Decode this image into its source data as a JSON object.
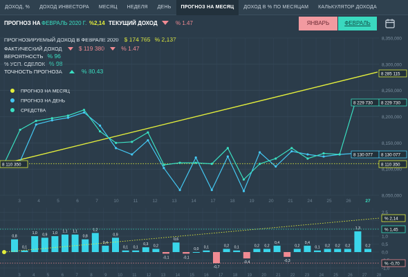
{
  "tabs": [
    "ДОХОД, %",
    "ДОХОД ИНВЕСТОРА",
    "МЕСЯЦ",
    "НЕДЕЛЯ",
    "ДЕНЬ",
    "ПРОГНОЗ НА МЕСЯЦ",
    "ДОХОД В % ПО МЕСЯЦАМ",
    "КАЛЬКУЛЯТОР ДОХОДА"
  ],
  "active_tab": 5,
  "header": {
    "prefix": "ПРОГНОЗ НА",
    "month": "ФЕВРАЛЬ 2020 Г.",
    "pct": "%2,14",
    "label": "ТЕКУЩИЙ ДОХОД",
    "current": "% 1.47"
  },
  "buttons": {
    "jan": "ЯНВАРЬ",
    "feb": "ФЕВРАЛЬ"
  },
  "info": {
    "forecast_label": "ПРОГНОЗИРУЕМЫЙ ДОХОД В ФЕВРАЛЕ 2020",
    "forecast_value": "$ 174 765",
    "forecast_pct": "% 2,137",
    "actual_label": "ФАКТИЧЕСКИЙ ДОХОД",
    "actual_value": "$ 119 380",
    "actual_pct": "% 1.47",
    "prob_label": "ВЕРОЯТНОСТЬ",
    "prob_value": "% 96",
    "deals_label": "% УСП. СДЕЛОК",
    "deals_value": "% 98",
    "acc_label": "ТОЧНОСТЬ ПРОГНОЗА",
    "acc_value": "% 80.43"
  },
  "legend": [
    {
      "name": "ПРОГНОЗ НА МЕСЯЦ",
      "color": "#e3ee3c"
    },
    {
      "name": "ПРОГНОЗ НА ДЕНЬ",
      "color": "#44c8f2"
    },
    {
      "name": "СРЕДСТВА",
      "color": "#3ae0c2"
    }
  ],
  "chart_data": [
    {
      "type": "line",
      "x": [
        1,
        2,
        3,
        4,
        5,
        6,
        7,
        8,
        9,
        10,
        11,
        12,
        13,
        14,
        15,
        16,
        17,
        18,
        19,
        20,
        21,
        22,
        23,
        24,
        25,
        26,
        27
      ],
      "x_labels": [
        "3",
        "4",
        "5",
        "6",
        "7",
        "10",
        "11",
        "12",
        "13",
        "14",
        "17",
        "18",
        "19",
        "20",
        "21",
        "24",
        "25",
        "26",
        "27"
      ],
      "highlight_label": "27",
      "y_ticks": [
        "8,350,000",
        "8,300,000",
        "8,250,000",
        "8,200,000",
        "8,150,000",
        "8,100,000",
        "8,050,000"
      ],
      "ylim": [
        8050000,
        8350000
      ],
      "series": [
        {
          "name": "ПРОГНОЗ НА МЕСЯЦ",
          "points": [
            [
              1,
              8110350
            ],
            [
              27,
              8285115
            ]
          ]
        },
        {
          "name": "ПРОГНОЗ НА ДЕНЬ",
          "points": [
            [
              1,
              8110350
            ],
            [
              2,
              8115000
            ],
            [
              3,
              8185000
            ],
            [
              4,
              8193000
            ],
            [
              5,
              8198000
            ],
            [
              6,
              8208000
            ],
            [
              7,
              8183000
            ],
            [
              8,
              8140000
            ],
            [
              9,
              8128000
            ],
            [
              10,
              8155000
            ],
            [
              11,
              8102000
            ],
            [
              12,
              8060000
            ],
            [
              13,
              8122000
            ],
            [
              14,
              8060000
            ],
            [
              15,
              8124000
            ],
            [
              16,
              8058000
            ],
            [
              17,
              8132000
            ],
            [
              18,
              8105000
            ],
            [
              19,
              8134000
            ],
            [
              20,
              8128000
            ],
            [
              21,
              8124000
            ],
            [
              22,
              8128000
            ],
            [
              23,
              8130077
            ]
          ]
        },
        {
          "name": "СРЕДСТВА",
          "points": [
            [
              1,
              8110350
            ],
            [
              2,
              8175000
            ],
            [
              3,
              8192000
            ],
            [
              4,
              8197000
            ],
            [
              5,
              8202000
            ],
            [
              6,
              8213000
            ],
            [
              7,
              8172000
            ],
            [
              8,
              8150000
            ],
            [
              9,
              8152000
            ],
            [
              10,
              8170000
            ],
            [
              11,
              8108000
            ],
            [
              12,
              8112000
            ],
            [
              13,
              8112000
            ],
            [
              14,
              8110000
            ],
            [
              15,
              8140000
            ],
            [
              16,
              8080000
            ],
            [
              17,
              8110000
            ],
            [
              18,
              8120000
            ],
            [
              19,
              8140000
            ],
            [
              20,
              8120000
            ],
            [
              21,
              8130000
            ],
            [
              22,
              8128000
            ],
            [
              23,
              8229730
            ]
          ]
        }
      ],
      "value_tags": [
        "8 285 115",
        "8 229 730",
        "8 229 730",
        "8 130 077",
        "8 130 077",
        "8 110 350",
        "8 110 350"
      ]
    },
    {
      "type": "bar",
      "categories": [
        "3",
        "4",
        "5",
        "6",
        "7",
        "10",
        "11",
        "12",
        "13",
        "14",
        "17",
        "18",
        "19",
        "20",
        "21",
        "24",
        "25",
        "26",
        "27"
      ],
      "x_tick_labels": [
        "3",
        "4",
        "5",
        "6",
        "7",
        "8",
        "9",
        "10",
        "11",
        "12",
        "13",
        "14",
        "15",
        "16",
        "17",
        "18",
        "19",
        "20",
        "21",
        "22",
        "23",
        "24",
        "25",
        "26",
        "27",
        "28"
      ],
      "values": [
        0.8,
        0.1,
        1.0,
        0.9,
        1.0,
        1.1,
        1.1,
        0.8,
        1.2,
        0.4,
        0.9,
        0.1,
        0.1,
        0.3,
        0.2,
        -0.1,
        0.6,
        -0.1,
        0.0,
        0.1,
        -0.7,
        0.2,
        0.1,
        -0.4,
        0.2,
        0.2,
        0.4,
        -0.3,
        0.2,
        0.4,
        0.1,
        0.2,
        0.2,
        0.2,
        1.3,
        0.2
      ],
      "value_labels": [
        "0,8",
        "0,1",
        "1,0",
        "0,9",
        "1,0",
        "1,1",
        "1,1",
        "0,8",
        "1,2",
        "0,4",
        "0,9",
        "0,1",
        "0,1",
        "0,3",
        "0,2",
        "-0,1",
        "0,6",
        "-0,1",
        "0,0",
        "0,1",
        "-0,7",
        "0,2",
        "0,1",
        "-0,4",
        "0,2",
        "0,2",
        "0,4",
        "-0,3",
        "0,2",
        "0,4",
        "0,1",
        "0,2",
        "0,2",
        "0,2",
        "1,3",
        "0,2"
      ],
      "y_ticks": [
        "2,5",
        "2,0",
        "1,5",
        "1,0",
        "0,5",
        "0,0",
        "-0,5",
        "-1,0"
      ],
      "ylim": [
        -1.0,
        2.5
      ],
      "tags": [
        "% 2,14",
        "% 1,45",
        "% -0,70"
      ]
    }
  ]
}
